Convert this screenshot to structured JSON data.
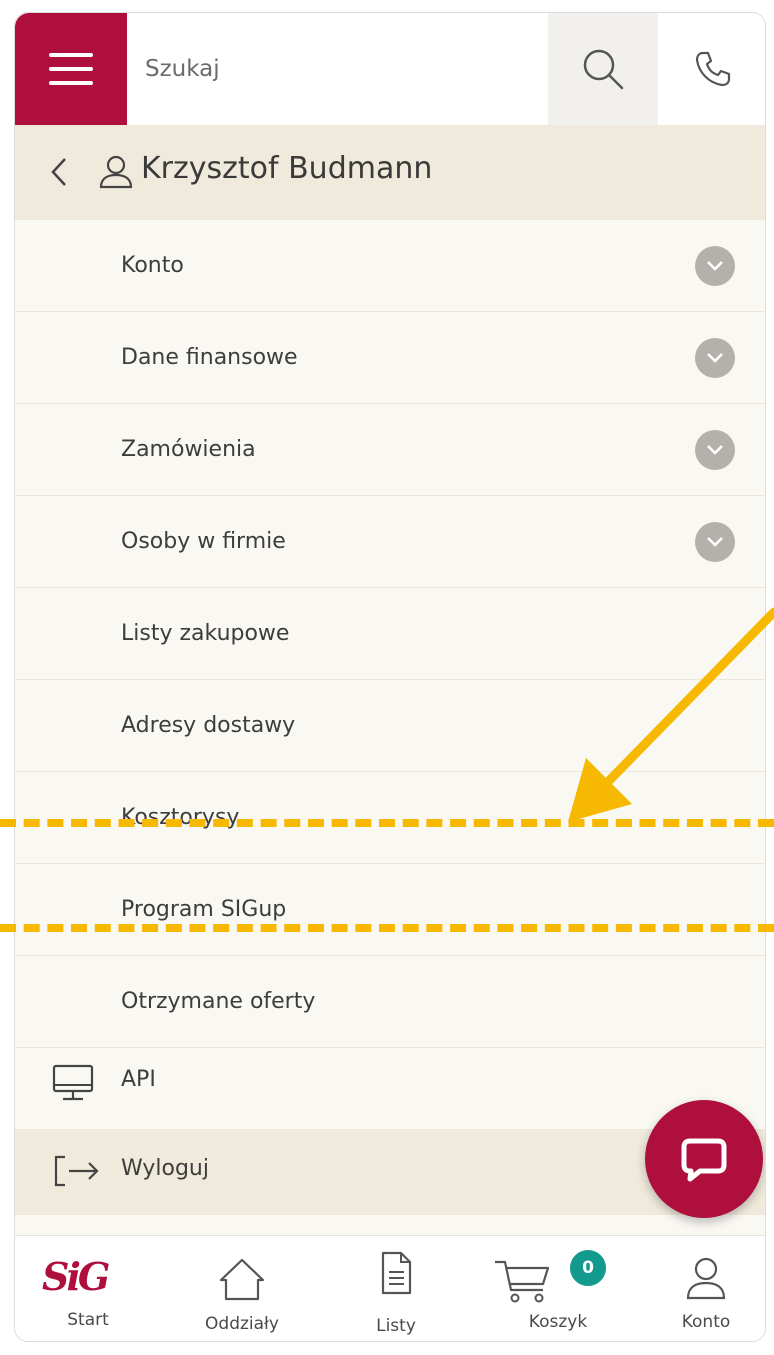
{
  "header": {
    "search_placeholder": "Szukaj"
  },
  "user": {
    "name": "Krzysztof Budmann"
  },
  "menu": {
    "items": [
      {
        "label": "Konto",
        "expandable": true
      },
      {
        "label": "Dane finansowe",
        "expandable": true
      },
      {
        "label": "Zamówienia",
        "expandable": true
      },
      {
        "label": "Osoby w firmie",
        "expandable": true
      },
      {
        "label": "Listy zakupowe",
        "expandable": false
      },
      {
        "label": "Adresy dostawy",
        "expandable": false
      },
      {
        "label": "Kosztorysy",
        "expandable": false
      },
      {
        "label": "Program SIGup",
        "expandable": false
      },
      {
        "label": "Otrzymane oferty",
        "expandable": false
      }
    ],
    "api_label": "API",
    "logout_label": "Wyloguj"
  },
  "bottom_nav": {
    "start": "Start",
    "branches": "Oddziały",
    "lists": "Listy",
    "cart": "Koszyk",
    "cart_count": "0",
    "account": "Konto"
  },
  "colors": {
    "brand": "#ae0f3c",
    "header_bg": "#efeadc",
    "badge": "#139a8f",
    "highlight": "#f6b800"
  }
}
